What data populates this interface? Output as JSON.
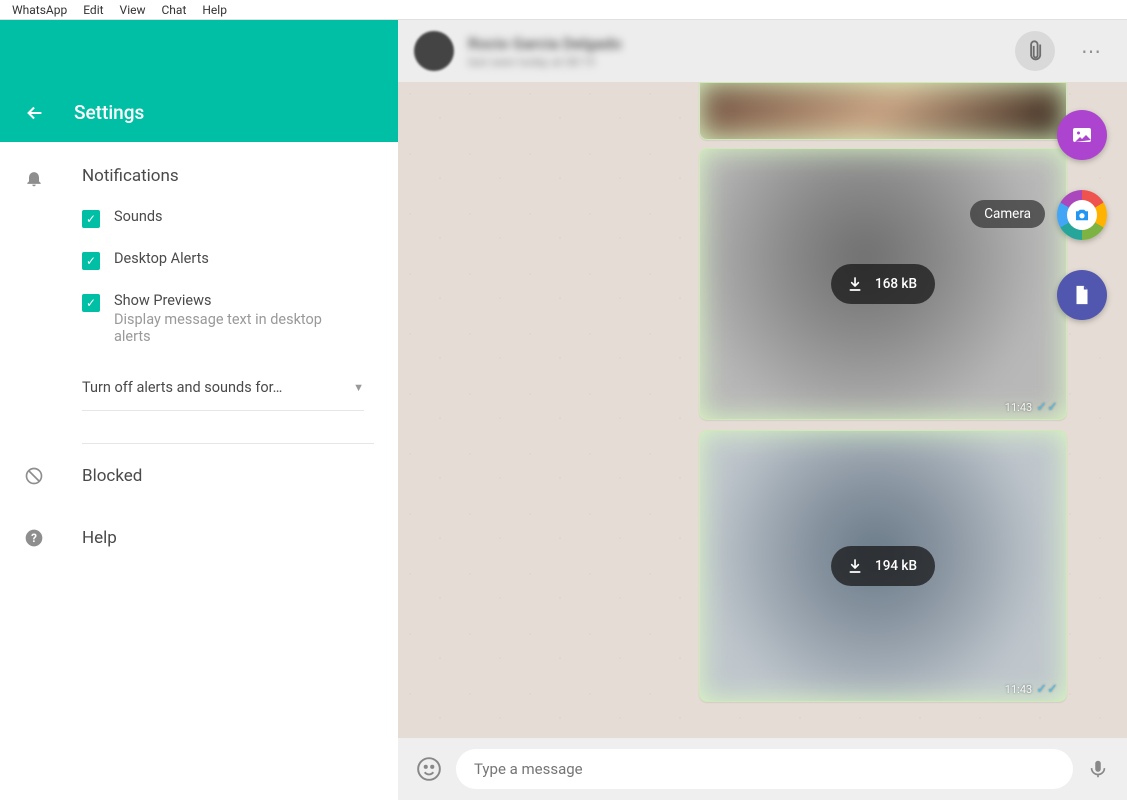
{
  "menubar": [
    "WhatsApp",
    "Edit",
    "View",
    "Chat",
    "Help"
  ],
  "settings": {
    "title": "Settings",
    "notifications": {
      "title": "Notifications",
      "sounds": "Sounds",
      "desktop_alerts": "Desktop Alerts",
      "show_previews": "Show Previews",
      "show_previews_sub": "Display message text in desktop alerts",
      "turnoff": "Turn off alerts and sounds for…"
    },
    "blocked": "Blocked",
    "help": "Help"
  },
  "chat": {
    "contact_name": "Rocio Garcia Delgado",
    "contact_status": "last seen today at 08:19",
    "messages": [
      {
        "size": "",
        "time": ""
      },
      {
        "size": "168 kB",
        "time": "11:43"
      },
      {
        "size": "194 kB",
        "time": "11:43"
      }
    ],
    "camera_label": "Camera"
  },
  "input": {
    "placeholder": "Type a message"
  }
}
